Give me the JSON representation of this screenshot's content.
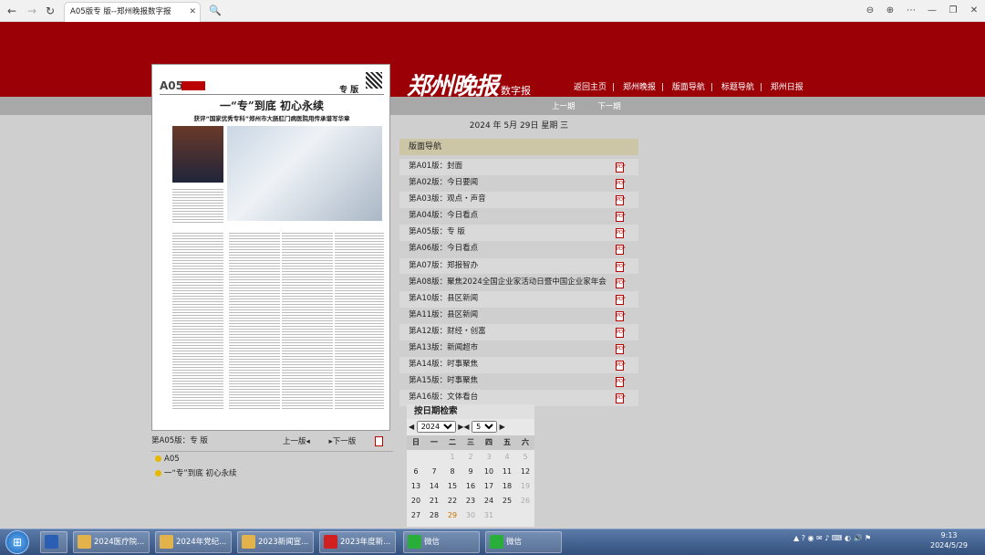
{
  "browser": {
    "tab_title": "A05版专 版--郑州晚报数字报",
    "back": "←",
    "forward": "→",
    "reload": "↻",
    "new_tab": "🔍",
    "right_icons": [
      "⊖",
      "⊕",
      "⋯",
      "—",
      "❐",
      "✕"
    ]
  },
  "site": {
    "logo": "郑州晚报",
    "logo_sub": "数字报",
    "top_nav": [
      "返回主页",
      "郑州晚报",
      "版面导航",
      "标题导航",
      "郑州日报"
    ],
    "top_nav_sep": "|",
    "prev_page": "上一期",
    "next_page": "下一期"
  },
  "paper": {
    "page_code": "A05",
    "header_label": "专 版",
    "headline": "一“专”到底 初心永续",
    "subhead": "获评“国家优秀专科”郑州市大肠肛门病医院用传承谱写华章"
  },
  "below_paper": {
    "label": "第A05版：专 版",
    "prev": "上一版◂",
    "next": "▸下一版"
  },
  "articles": [
    "A05",
    "一“专”到底 初心永续"
  ],
  "date": "2024 年 5月 29日  星期 三",
  "sections_title": "版面导航",
  "sections": [
    "第A01版：封面",
    "第A02版：今日要闻",
    "第A03版：观点・声音",
    "第A04版：今日看点",
    "第A05版：专 版",
    "第A06版：今日看点",
    "第A07版：郑报智办",
    "第A08版：聚焦2024全国企业家活动日暨中国企业家年会",
    "第A10版：县区新闻",
    "第A11版：县区新闻",
    "第A12版：财经・创富",
    "第A13版：新闻超市",
    "第A14版：时事聚焦",
    "第A15版：时事聚焦",
    "第A16版：文体看台"
  ],
  "calendar": {
    "title": "按日期检索",
    "year": "2024",
    "month": "5",
    "weekdays": [
      "日",
      "一",
      "二",
      "三",
      "四",
      "五",
      "六"
    ],
    "days": [
      {
        "d": "",
        "g": true
      },
      {
        "d": "",
        "g": true
      },
      {
        "d": "1",
        "g": true
      },
      {
        "d": "2",
        "g": true
      },
      {
        "d": "3",
        "g": true
      },
      {
        "d": "4",
        "g": true
      },
      {
        "d": "5",
        "g": true
      },
      {
        "d": "6"
      },
      {
        "d": "7"
      },
      {
        "d": "8"
      },
      {
        "d": "9"
      },
      {
        "d": "10"
      },
      {
        "d": "11"
      },
      {
        "d": "12"
      },
      {
        "d": "13"
      },
      {
        "d": "14"
      },
      {
        "d": "15"
      },
      {
        "d": "16"
      },
      {
        "d": "17"
      },
      {
        "d": "18"
      },
      {
        "d": "19",
        "g": true
      },
      {
        "d": "20"
      },
      {
        "d": "21"
      },
      {
        "d": "22"
      },
      {
        "d": "23"
      },
      {
        "d": "24"
      },
      {
        "d": "25"
      },
      {
        "d": "26",
        "g": true
      },
      {
        "d": "27"
      },
      {
        "d": "28"
      },
      {
        "d": "29",
        "t": true
      },
      {
        "d": "30",
        "g": true
      },
      {
        "d": "31",
        "g": true
      }
    ]
  },
  "taskbar": {
    "items": [
      {
        "label": "",
        "color": "#2b5fb3"
      },
      {
        "label": "2024医疗院...",
        "color": "#e2b34a"
      },
      {
        "label": "2024年党纪...",
        "color": "#e2b34a"
      },
      {
        "label": "2023新闻宣...",
        "color": "#e2b34a"
      },
      {
        "label": "2023年度新...",
        "color": "#d02020"
      },
      {
        "label": "微信",
        "color": "#2aae3a"
      },
      {
        "label": "微信",
        "color": "#2aae3a"
      }
    ],
    "time": "9:13",
    "date": "2024/5/29"
  }
}
